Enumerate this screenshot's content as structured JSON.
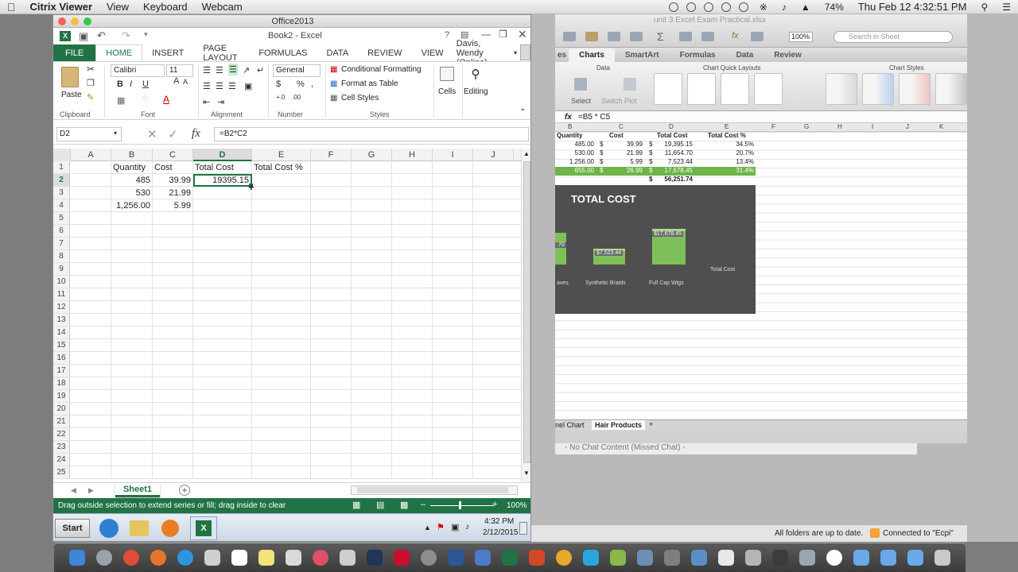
{
  "menubar": {
    "items": [
      "Citrix Viewer",
      "View",
      "Keyboard",
      "Webcam"
    ],
    "battery": "74%",
    "clock": "Thu Feb 12  4:32:51 PM"
  },
  "window": {
    "title": "Office2013"
  },
  "excel": {
    "title": "Book2 - Excel",
    "help": "?",
    "tabs": [
      "FILE",
      "HOME",
      "INSERT",
      "PAGE LAYOUT",
      "FORMULAS",
      "DATA",
      "REVIEW",
      "VIEW"
    ],
    "user": "Davis, Wendy (Online)",
    "ribbon": {
      "paste": "Paste",
      "clipboard": "Clipboard",
      "font_name": "Calibri",
      "font_size": "11",
      "font_group": "Font",
      "bold": "B",
      "italic": "I",
      "underline": "U",
      "font_color": "A",
      "grow": "A",
      "shrink": "A",
      "alignment_group": "Alignment",
      "number_format": "General",
      "number_group": "Number",
      "currency": "$",
      "percent": "%",
      "comma": ",",
      "inc_dec": "+.0",
      "dec_dec": ".00",
      "conditional_formatting": "Conditional Formatting",
      "format_as_table": "Format as Table",
      "cell_styles": "Cell Styles",
      "styles_group": "Styles",
      "cells": "Cells",
      "editing": "Editing"
    },
    "name_box": "D2",
    "fx": "fx",
    "formula": "=B2*C2",
    "columns": [
      "A",
      "B",
      "C",
      "D",
      "E",
      "F",
      "G",
      "H",
      "I",
      "J"
    ],
    "rows": [
      "1",
      "2",
      "3",
      "4",
      "5",
      "6",
      "7",
      "8",
      "9",
      "10",
      "11",
      "12",
      "13",
      "14",
      "15",
      "16",
      "17",
      "18",
      "19",
      "20",
      "21",
      "22",
      "23",
      "24",
      "25"
    ],
    "cells": {
      "b1": "Quantity",
      "c1": "Cost",
      "d1": "Total Cost",
      "e1": "Total Cost %",
      "b2": "485",
      "c2": "39.99",
      "d2": "19395.15",
      "b3": "530",
      "c3": "21.99",
      "b4": "1,256.00",
      "c4": "5.99"
    },
    "sheet_tab": "Sheet1",
    "add_sheet": "+",
    "status": "Drag outside selection to extend series or fill; drag inside to clear",
    "zoom": "100%"
  },
  "taskbar": {
    "start": "Start",
    "time": "4:32 PM",
    "date": "2/12/2015"
  },
  "bg_excel": {
    "title": "unit 3 Excel Exam Practical.xlsx",
    "search": "Search in Sheet",
    "zoom": "100%",
    "tabs": [
      "es",
      "Charts",
      "SmartArt",
      "Formulas",
      "Data",
      "Review"
    ],
    "groups": {
      "data": "Data",
      "quick": "Chart Quick Layouts",
      "styles": "Chart Styles"
    },
    "select": "Select",
    "switch_plot": "Switch Plot",
    "formula": "=B5 * C5",
    "columns": [
      "B",
      "C",
      "D",
      "E",
      "F",
      "G",
      "H",
      "I",
      "J",
      "K"
    ],
    "header_row": [
      "Quantity",
      "Cost",
      "Total Cost",
      "Total Cost %"
    ],
    "rows": [
      [
        "485.00",
        "$",
        "39.99",
        "$",
        "19,395.15",
        "34.5%"
      ],
      [
        "530.00",
        "$",
        "21.99",
        "$",
        "11,654.70",
        "20.7%"
      ],
      [
        "1,256.00",
        "$",
        "5.99",
        "$",
        "7,523.44",
        "13.4%"
      ],
      [
        "655.00",
        "$",
        "26.99",
        "$",
        "17,678.45",
        "31.4%"
      ]
    ],
    "total": [
      "$",
      "56,251.74"
    ],
    "chart": {
      "title": "TOTAL COST",
      "labels": [
        ".70",
        "$7,523.44",
        "$17,678.45"
      ],
      "categories": [
        "aves",
        "Synthetic Braids",
        "Full Cap Wigs"
      ],
      "legend": "Total Cost"
    },
    "sheet_tabs": [
      "nel Chart",
      "Hair Products",
      "+"
    ],
    "chat": "- No Chat Content (Missed Chat) -"
  },
  "right_status": {
    "sync": "All folders are up to date.",
    "connected": "Connected to \"Ecpi\""
  }
}
